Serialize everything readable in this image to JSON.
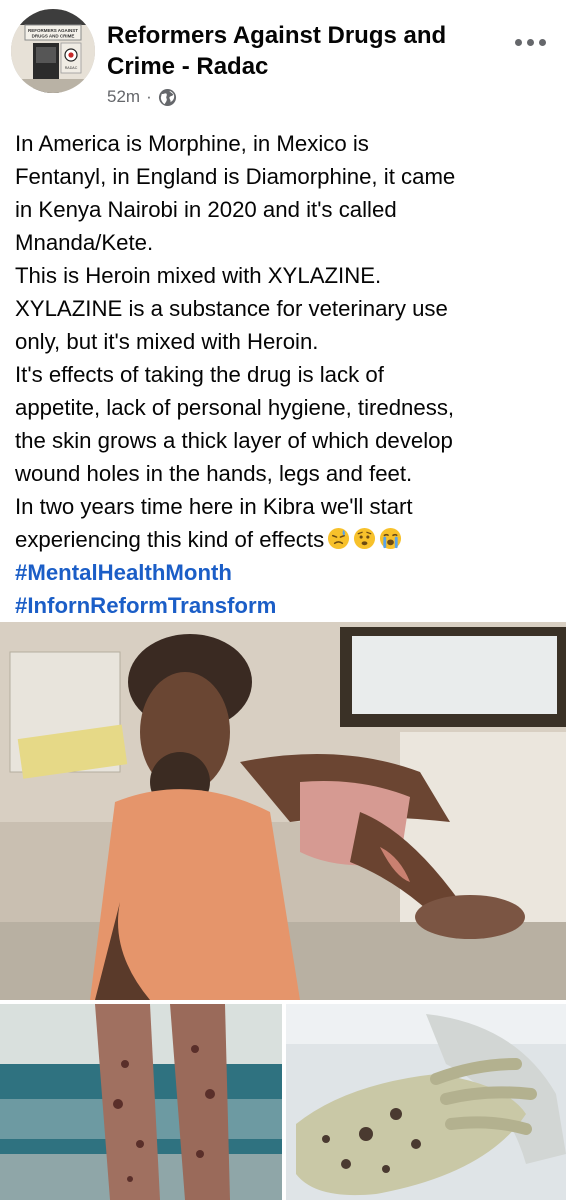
{
  "page": {
    "name": "Reformers Against Drugs and Crime - Radac",
    "timestamp": "52m",
    "separator": "·",
    "audience_icon": "globe-icon",
    "more_icon": "more-dots-icon"
  },
  "avatar": {
    "sign_line1": "REFORMERS AGAINST",
    "sign_line2": "DRUGS AND CRIME",
    "sign_side": "RADAC"
  },
  "post": {
    "lines": [
      "In America is Morphine, in Mexico is",
      "Fentanyl, in England is Diamorphine, it came",
      "in Kenya Nairobi in 2020 and it's called",
      "Mnanda/Kete.",
      "This is Heroin mixed with XYLAZINE.",
      "XYLAZINE is a substance for veterinary use",
      "only, but it's mixed with Heroin.",
      "It's effects of taking the drug is lack of",
      "appetite, lack of personal hygiene, tiredness,",
      "the skin grows a thick layer of which develop",
      "wound holes in the hands, legs and feet.",
      "In two years time here in Kibra we'll start",
      "experiencing this kind of effects"
    ],
    "emojis": [
      "sleepy-face-emoji",
      "worried-face-emoji",
      "loudly-crying-face-emoji"
    ],
    "hashtags": [
      "#MentalHealthMonth",
      "#InfornReformTransform"
    ]
  },
  "photos": [
    "man-with-skin-wounds-photo",
    "wounded-legs-photo",
    "wounded-hand-photo"
  ],
  "colors": {
    "hashtag": "#1b5ec7",
    "meta": "#65676b",
    "text": "#050505",
    "background": "#ffffff"
  }
}
